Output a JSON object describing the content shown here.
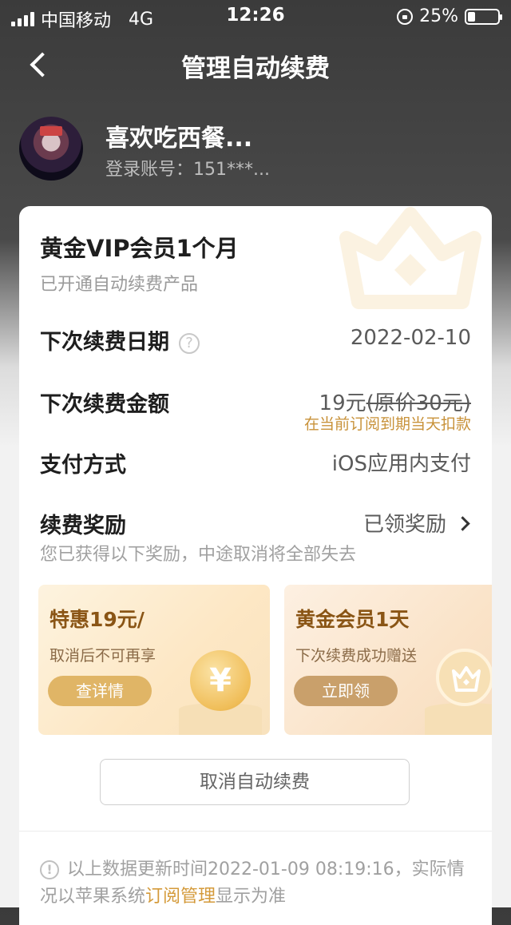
{
  "status_bar": {
    "carrier": "中国移动",
    "network": "4G",
    "time": "12:26",
    "battery_text": "25%",
    "battery_level": 0.25
  },
  "nav": {
    "title": "管理自动续费"
  },
  "profile": {
    "name": "喜欢吃西餐...",
    "account": "登录账号：151***..."
  },
  "subscription": {
    "title": "黄金VIP会员1个月",
    "subtitle": "已开通自动续费产品"
  },
  "rows": {
    "next_date_label": "下次续费日期",
    "next_date_value": "2022-02-10",
    "next_amount_label": "下次续费金额",
    "next_amount_price": "19元",
    "next_amount_original": "(原价30元)",
    "next_amount_note": "在当前订阅到期当天扣款",
    "payment_label": "支付方式",
    "payment_value": "iOS应用内支付",
    "reward_label": "续费奖励",
    "reward_value": "已领奖励",
    "reward_sub": "您已获得以下奖励，中途取消将全部失去"
  },
  "rewards": [
    {
      "title": "特惠19元/",
      "desc": "取消后不可再享",
      "button": "查详情",
      "icon": "yuan-coin-icon",
      "coin_glyph": "¥"
    },
    {
      "title": "黄金会员1天",
      "desc": "下次续费成功赠送",
      "button": "立即领",
      "icon": "crown-icon"
    }
  ],
  "cancel_button": "取消自动续费",
  "footnote": {
    "text_before": "以上数据更新时间2022-01-09 08:19:16，实际情况以苹果系统",
    "link": "订阅管理",
    "text_after": "显示为准"
  },
  "colors": {
    "accent": "#d49a3a",
    "header_bg": "#3b3b3b"
  }
}
